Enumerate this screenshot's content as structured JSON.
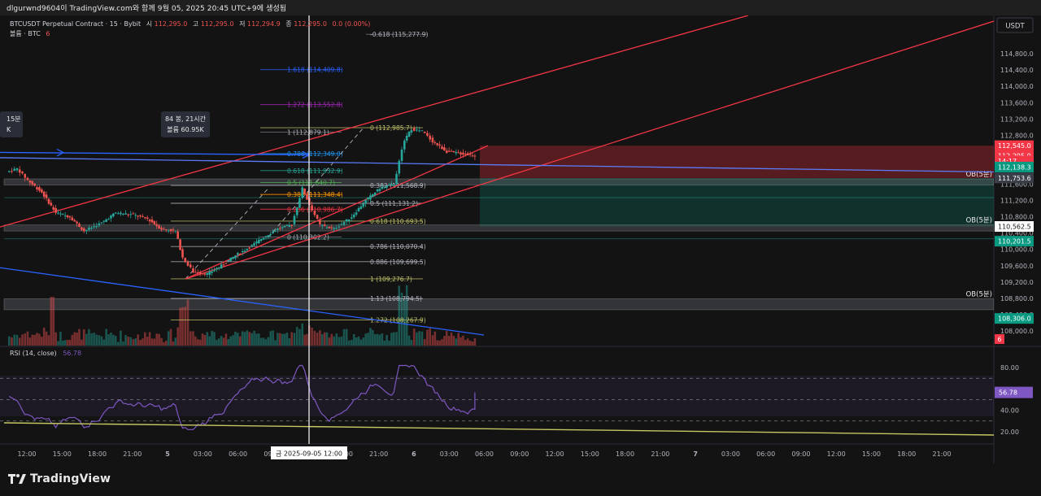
{
  "header": {
    "caption": "dlgurwnd9604이 TradingView.com와 함께 9월 05, 2025 20:45 UTC+9에 생성됨"
  },
  "legend": {
    "symbol_line": "BTCUSDT Perpetual Contract · 15 · Bybit",
    "ohlc": [
      {
        "label": "시",
        "value": "112,295.0"
      },
      {
        "label": "고",
        "value": "112,295.0"
      },
      {
        "label": "저",
        "value": "112,294.9"
      },
      {
        "label": "종",
        "value": "112,295.0"
      }
    ],
    "change": "0.0 (0.00%)",
    "volume_line": "볼륨 · BTC",
    "volume_value": "6",
    "rsi_label": "RSI (14, close)",
    "rsi_value": "56.78"
  },
  "currency_button": "USDT",
  "colors": {
    "background": "#131313",
    "up": "#26a69a",
    "down": "#ef5350",
    "blue_line": "#2962ff",
    "trend_red": "#f23645",
    "rsi_line": "#7e57c2",
    "fib_level": "#b2b5be",
    "fib_accent": "#c0c06a"
  },
  "chart_data": {
    "type": "candlestick",
    "symbol": "BTCUSDT",
    "timeframe": "15",
    "price_axis": {
      "ylim": [
        107640,
        115740
      ],
      "ticks": [
        114800.0,
        114400.0,
        114000.0,
        113600.0,
        113200.0,
        112800.0,
        111600.0,
        111200.0,
        110800.0,
        110400.0,
        110000.0,
        109600.0,
        109200.0,
        108800.0,
        108400.0,
        108000.0
      ],
      "markers": [
        {
          "label": "112,545.0",
          "price": 112545,
          "style": "down"
        },
        {
          "label": "112,295.0",
          "price": 112295,
          "style": "down"
        },
        {
          "label": "14:17",
          "price": 112170,
          "style": "down"
        },
        {
          "label": "112,138.3",
          "price": 112020,
          "style": "up"
        },
        {
          "label": "111,753.6",
          "price": 111753.6,
          "style": "gray"
        },
        {
          "label": "110,562.5",
          "price": 110562.5,
          "style": "white"
        },
        {
          "label": "110,201.5",
          "price": 110201.5,
          "style": "up"
        },
        {
          "label": "108,306.0",
          "price": 108306,
          "style": "up"
        }
      ]
    },
    "time_axis": {
      "labels": [
        "12:00",
        "15:00",
        "18:00",
        "21:00",
        "5",
        "03:00",
        "06:00",
        "09:00",
        "15:00",
        "18:00",
        "21:00",
        "6",
        "03:00",
        "06:00",
        "09:00",
        "12:00",
        "15:00",
        "18:00",
        "21:00",
        "7",
        "03:00",
        "06:00",
        "09:00",
        "12:00",
        "15:00",
        "18:00",
        "21:00"
      ],
      "crosshair_label": "금 2025-09-05   12:00"
    },
    "fib_levels": [
      {
        "label": "-0.618 (115,277.9)",
        "price": 115277.9
      },
      {
        "label": "1.618 (114,409.8)",
        "price": 114409.8
      },
      {
        "label": "1.272 (113,552.8)",
        "price": 113552.8
      },
      {
        "label": "1 (112,879.1)",
        "price": 112879.1
      },
      {
        "label": "0 (112,985.7)",
        "price": 112985.7
      },
      {
        "label": "0.786 (112,349.0)",
        "price": 112349.0
      },
      {
        "label": "0.618 (111,932.9)",
        "price": 111932.9
      },
      {
        "label": "0.5 (111,640.7)",
        "price": 111640.7
      },
      {
        "label": "0.382 (111,568.9)",
        "price": 111568.9
      },
      {
        "label": "0.382 (111,348.4)",
        "price": 111348.4
      },
      {
        "label": "0.5 (111,131.2)",
        "price": 111131.2
      },
      {
        "label": "0.236 (110,986.7)",
        "price": 110986.7
      },
      {
        "label": "0.618 (110,693.5)",
        "price": 110693.5
      },
      {
        "label": "0 (110,302.2)",
        "price": 110302.2
      },
      {
        "label": "0.786 (110,070.4)",
        "price": 110070.4
      },
      {
        "label": "0.886 (109,699.5)",
        "price": 109699.5
      },
      {
        "label": "1 (109,276.7)",
        "price": 109276.7
      },
      {
        "label": "1.13 (108,794.5)",
        "price": 108794.5
      },
      {
        "label": "1.272 (108,267.9)",
        "price": 108267.9
      }
    ],
    "order_blocks": [
      {
        "label": "OB(5분)",
        "top": 111730,
        "bottom": 111580
      },
      {
        "label": "OB(5분)",
        "top": 110600,
        "bottom": 110450
      },
      {
        "label": "OB(5분)",
        "top": 108790,
        "bottom": 108520
      }
    ],
    "zones": [
      {
        "kind": "supply",
        "top": 112545,
        "bottom": 111750
      },
      {
        "kind": "demand",
        "top": 111750,
        "bottom": 110560
      }
    ],
    "measure_tooltip": {
      "bars": "84 봉, 21시간",
      "volume": "볼륨 60.95K"
    },
    "left_edge_tooltip": {
      "line1": "15분",
      "line2": "K"
    },
    "close_path": [
      [
        0,
        111900
      ],
      [
        0.3,
        111980
      ],
      [
        0.6,
        111700
      ],
      [
        1.0,
        111400
      ],
      [
        1.4,
        110900
      ],
      [
        1.8,
        110800
      ],
      [
        2.2,
        110450
      ],
      [
        2.7,
        110650
      ],
      [
        3.1,
        110900
      ],
      [
        3.6,
        110850
      ],
      [
        4.0,
        110750
      ],
      [
        4.4,
        110500
      ],
      [
        4.8,
        110450
      ],
      [
        5.0,
        109800
      ],
      [
        5.3,
        109450
      ],
      [
        5.7,
        109400
      ],
      [
        6.1,
        109600
      ],
      [
        6.5,
        109850
      ],
      [
        6.9,
        110050
      ],
      [
        7.3,
        110300
      ],
      [
        7.7,
        110500
      ],
      [
        8.1,
        110600
      ],
      [
        8.4,
        111500
      ],
      [
        8.6,
        111100
      ],
      [
        8.9,
        110600
      ],
      [
        9.3,
        110500
      ],
      [
        9.8,
        110800
      ],
      [
        10.2,
        111200
      ],
      [
        10.6,
        111500
      ],
      [
        11.0,
        111600
      ],
      [
        11.3,
        112700
      ],
      [
        11.5,
        112950
      ],
      [
        11.8,
        112900
      ],
      [
        12.1,
        112650
      ],
      [
        12.5,
        112400
      ],
      [
        12.9,
        112350
      ],
      [
        13.3,
        112300
      ]
    ],
    "volume_scale": {
      "max": 60.95,
      "unit": "K"
    },
    "rsi": {
      "ylim": [
        10,
        90
      ],
      "ticks": [
        80.0,
        40.0,
        20.0
      ],
      "bands": [
        70,
        50,
        30
      ],
      "value": 56.78
    }
  }
}
